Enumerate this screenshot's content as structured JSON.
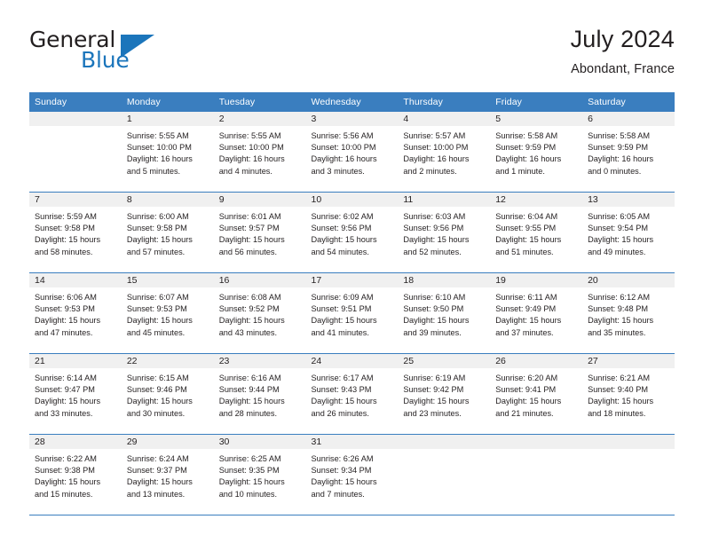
{
  "brand": {
    "line1": "General",
    "line2": "Blue",
    "flag_icon": "blue-triangle-flag-icon"
  },
  "header": {
    "title": "July 2024",
    "subtitle": "Abondant, France"
  },
  "colors": {
    "header_blue": "#3a7ebf",
    "brand_blue": "#1b75bb",
    "daynum_strip": "#f0f0f0",
    "text": "#231f20"
  },
  "calendar": {
    "weekday_headers": [
      "Sunday",
      "Monday",
      "Tuesday",
      "Wednesday",
      "Thursday",
      "Friday",
      "Saturday"
    ],
    "weeks": [
      [
        {
          "day": "",
          "lines": [
            "",
            "",
            "",
            ""
          ]
        },
        {
          "day": "1",
          "lines": [
            "Sunrise: 5:55 AM",
            "Sunset: 10:00 PM",
            "Daylight: 16 hours",
            "and 5 minutes."
          ]
        },
        {
          "day": "2",
          "lines": [
            "Sunrise: 5:55 AM",
            "Sunset: 10:00 PM",
            "Daylight: 16 hours",
            "and 4 minutes."
          ]
        },
        {
          "day": "3",
          "lines": [
            "Sunrise: 5:56 AM",
            "Sunset: 10:00 PM",
            "Daylight: 16 hours",
            "and 3 minutes."
          ]
        },
        {
          "day": "4",
          "lines": [
            "Sunrise: 5:57 AM",
            "Sunset: 10:00 PM",
            "Daylight: 16 hours",
            "and 2 minutes."
          ]
        },
        {
          "day": "5",
          "lines": [
            "Sunrise: 5:58 AM",
            "Sunset: 9:59 PM",
            "Daylight: 16 hours",
            "and 1 minute."
          ]
        },
        {
          "day": "6",
          "lines": [
            "Sunrise: 5:58 AM",
            "Sunset: 9:59 PM",
            "Daylight: 16 hours",
            "and 0 minutes."
          ]
        }
      ],
      [
        {
          "day": "7",
          "lines": [
            "Sunrise: 5:59 AM",
            "Sunset: 9:58 PM",
            "Daylight: 15 hours",
            "and 58 minutes."
          ]
        },
        {
          "day": "8",
          "lines": [
            "Sunrise: 6:00 AM",
            "Sunset: 9:58 PM",
            "Daylight: 15 hours",
            "and 57 minutes."
          ]
        },
        {
          "day": "9",
          "lines": [
            "Sunrise: 6:01 AM",
            "Sunset: 9:57 PM",
            "Daylight: 15 hours",
            "and 56 minutes."
          ]
        },
        {
          "day": "10",
          "lines": [
            "Sunrise: 6:02 AM",
            "Sunset: 9:56 PM",
            "Daylight: 15 hours",
            "and 54 minutes."
          ]
        },
        {
          "day": "11",
          "lines": [
            "Sunrise: 6:03 AM",
            "Sunset: 9:56 PM",
            "Daylight: 15 hours",
            "and 52 minutes."
          ]
        },
        {
          "day": "12",
          "lines": [
            "Sunrise: 6:04 AM",
            "Sunset: 9:55 PM",
            "Daylight: 15 hours",
            "and 51 minutes."
          ]
        },
        {
          "day": "13",
          "lines": [
            "Sunrise: 6:05 AM",
            "Sunset: 9:54 PM",
            "Daylight: 15 hours",
            "and 49 minutes."
          ]
        }
      ],
      [
        {
          "day": "14",
          "lines": [
            "Sunrise: 6:06 AM",
            "Sunset: 9:53 PM",
            "Daylight: 15 hours",
            "and 47 minutes."
          ]
        },
        {
          "day": "15",
          "lines": [
            "Sunrise: 6:07 AM",
            "Sunset: 9:53 PM",
            "Daylight: 15 hours",
            "and 45 minutes."
          ]
        },
        {
          "day": "16",
          "lines": [
            "Sunrise: 6:08 AM",
            "Sunset: 9:52 PM",
            "Daylight: 15 hours",
            "and 43 minutes."
          ]
        },
        {
          "day": "17",
          "lines": [
            "Sunrise: 6:09 AM",
            "Sunset: 9:51 PM",
            "Daylight: 15 hours",
            "and 41 minutes."
          ]
        },
        {
          "day": "18",
          "lines": [
            "Sunrise: 6:10 AM",
            "Sunset: 9:50 PM",
            "Daylight: 15 hours",
            "and 39 minutes."
          ]
        },
        {
          "day": "19",
          "lines": [
            "Sunrise: 6:11 AM",
            "Sunset: 9:49 PM",
            "Daylight: 15 hours",
            "and 37 minutes."
          ]
        },
        {
          "day": "20",
          "lines": [
            "Sunrise: 6:12 AM",
            "Sunset: 9:48 PM",
            "Daylight: 15 hours",
            "and 35 minutes."
          ]
        }
      ],
      [
        {
          "day": "21",
          "lines": [
            "Sunrise: 6:14 AM",
            "Sunset: 9:47 PM",
            "Daylight: 15 hours",
            "and 33 minutes."
          ]
        },
        {
          "day": "22",
          "lines": [
            "Sunrise: 6:15 AM",
            "Sunset: 9:46 PM",
            "Daylight: 15 hours",
            "and 30 minutes."
          ]
        },
        {
          "day": "23",
          "lines": [
            "Sunrise: 6:16 AM",
            "Sunset: 9:44 PM",
            "Daylight: 15 hours",
            "and 28 minutes."
          ]
        },
        {
          "day": "24",
          "lines": [
            "Sunrise: 6:17 AM",
            "Sunset: 9:43 PM",
            "Daylight: 15 hours",
            "and 26 minutes."
          ]
        },
        {
          "day": "25",
          "lines": [
            "Sunrise: 6:19 AM",
            "Sunset: 9:42 PM",
            "Daylight: 15 hours",
            "and 23 minutes."
          ]
        },
        {
          "day": "26",
          "lines": [
            "Sunrise: 6:20 AM",
            "Sunset: 9:41 PM",
            "Daylight: 15 hours",
            "and 21 minutes."
          ]
        },
        {
          "day": "27",
          "lines": [
            "Sunrise: 6:21 AM",
            "Sunset: 9:40 PM",
            "Daylight: 15 hours",
            "and 18 minutes."
          ]
        }
      ],
      [
        {
          "day": "28",
          "lines": [
            "Sunrise: 6:22 AM",
            "Sunset: 9:38 PM",
            "Daylight: 15 hours",
            "and 15 minutes."
          ]
        },
        {
          "day": "29",
          "lines": [
            "Sunrise: 6:24 AM",
            "Sunset: 9:37 PM",
            "Daylight: 15 hours",
            "and 13 minutes."
          ]
        },
        {
          "day": "30",
          "lines": [
            "Sunrise: 6:25 AM",
            "Sunset: 9:35 PM",
            "Daylight: 15 hours",
            "and 10 minutes."
          ]
        },
        {
          "day": "31",
          "lines": [
            "Sunrise: 6:26 AM",
            "Sunset: 9:34 PM",
            "Daylight: 15 hours",
            "and 7 minutes."
          ]
        },
        {
          "day": "",
          "lines": [
            "",
            "",
            "",
            ""
          ]
        },
        {
          "day": "",
          "lines": [
            "",
            "",
            "",
            ""
          ]
        },
        {
          "day": "",
          "lines": [
            "",
            "",
            "",
            ""
          ]
        }
      ]
    ]
  }
}
